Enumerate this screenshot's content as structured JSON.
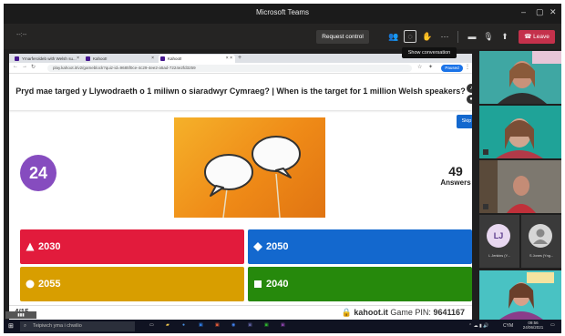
{
  "window": {
    "title": "Microsoft Teams"
  },
  "toolbar": {
    "timer": "--:--",
    "request_control_label": "Request control",
    "leave_label": "Leave",
    "tooltip": "Show conversation"
  },
  "browser": {
    "tabs": [
      {
        "label": "Ymarferoldeb with Welsh su..."
      },
      {
        "label": "Kahoot!"
      },
      {
        "label": "Kahoot!"
      }
    ],
    "url": "play.kahoot.it/v2/gameblock?quiz-id=9685f0ce-4c29-4ee2-a5ad-7224e2fd3259",
    "paused_label": "Paused"
  },
  "quiz": {
    "question": "Pryd mae targed y Llywodraeth o 1 miliwn o siaradwyr Cymraeg? | When is the target for 1 million Welsh speakers?",
    "timer": "24",
    "skip_label": "Skip",
    "answers_count": "49",
    "answers_label": "Answers",
    "options": [
      {
        "label": "2030",
        "color": "#e21b3c",
        "shape": "triangle"
      },
      {
        "label": "2050",
        "color": "#1368ce",
        "shape": "diamond"
      },
      {
        "label": "2055",
        "color": "#d89e00",
        "shape": "circle"
      },
      {
        "label": "2040",
        "color": "#26890c",
        "shape": "square"
      }
    ],
    "question_counter": "4/15",
    "site": "kahoot.it",
    "pin_label": "Game PIN:",
    "pin": "9641167"
  },
  "participants": {
    "avatars": [
      {
        "initials": "LJ",
        "name": "L Jenkins (Y..."
      },
      {
        "initials": "",
        "name": "S Jones (Yng..."
      }
    ]
  },
  "taskbar": {
    "search_placeholder": "Teipiwch yma i chwilio",
    "lang": "CYM",
    "time": "09:56",
    "date": "24/06/2021"
  }
}
